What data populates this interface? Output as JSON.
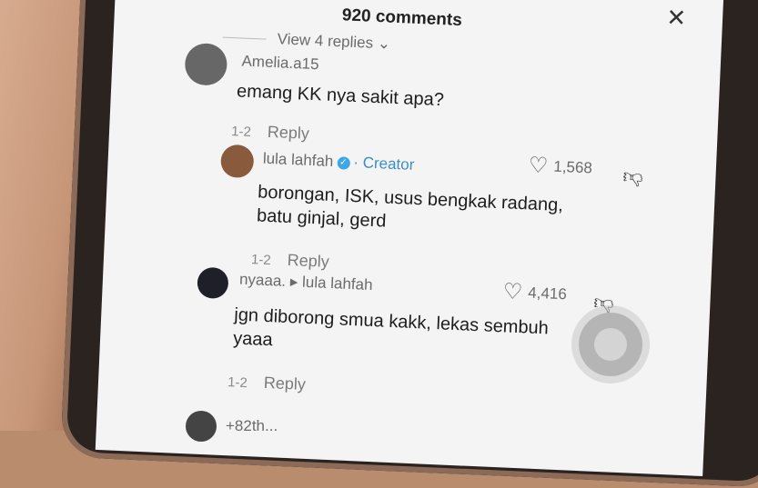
{
  "header": {
    "title": "920 comments"
  },
  "view_replies": {
    "label": "View 4 replies",
    "chevron": "chevron-down-icon"
  },
  "comments": [
    {
      "username": "Amelia.a15",
      "text": "emang KK nya sakit apa?",
      "date": "1-2",
      "reply": "Reply"
    },
    {
      "username": "lula lahfah",
      "badge": "Creator",
      "text": "borongan, ISK, usus bengkak radang, batu ginjal, gerd",
      "date": "1-2",
      "reply": "Reply",
      "likes": "1,568"
    },
    {
      "username": "nyaaa.",
      "reply_to": "lula lahfah",
      "text": "jgn diborong smua kakk, lekas sembuh yaaa",
      "date": "1-2",
      "reply": "Reply",
      "likes": "4,416"
    },
    {
      "username": "+82th..."
    }
  ],
  "colors": {
    "screen_bg": "#f4f4f5",
    "creator": "#3a8ec1",
    "text": "#1d1d1d",
    "meta": "#8a8a8a"
  }
}
